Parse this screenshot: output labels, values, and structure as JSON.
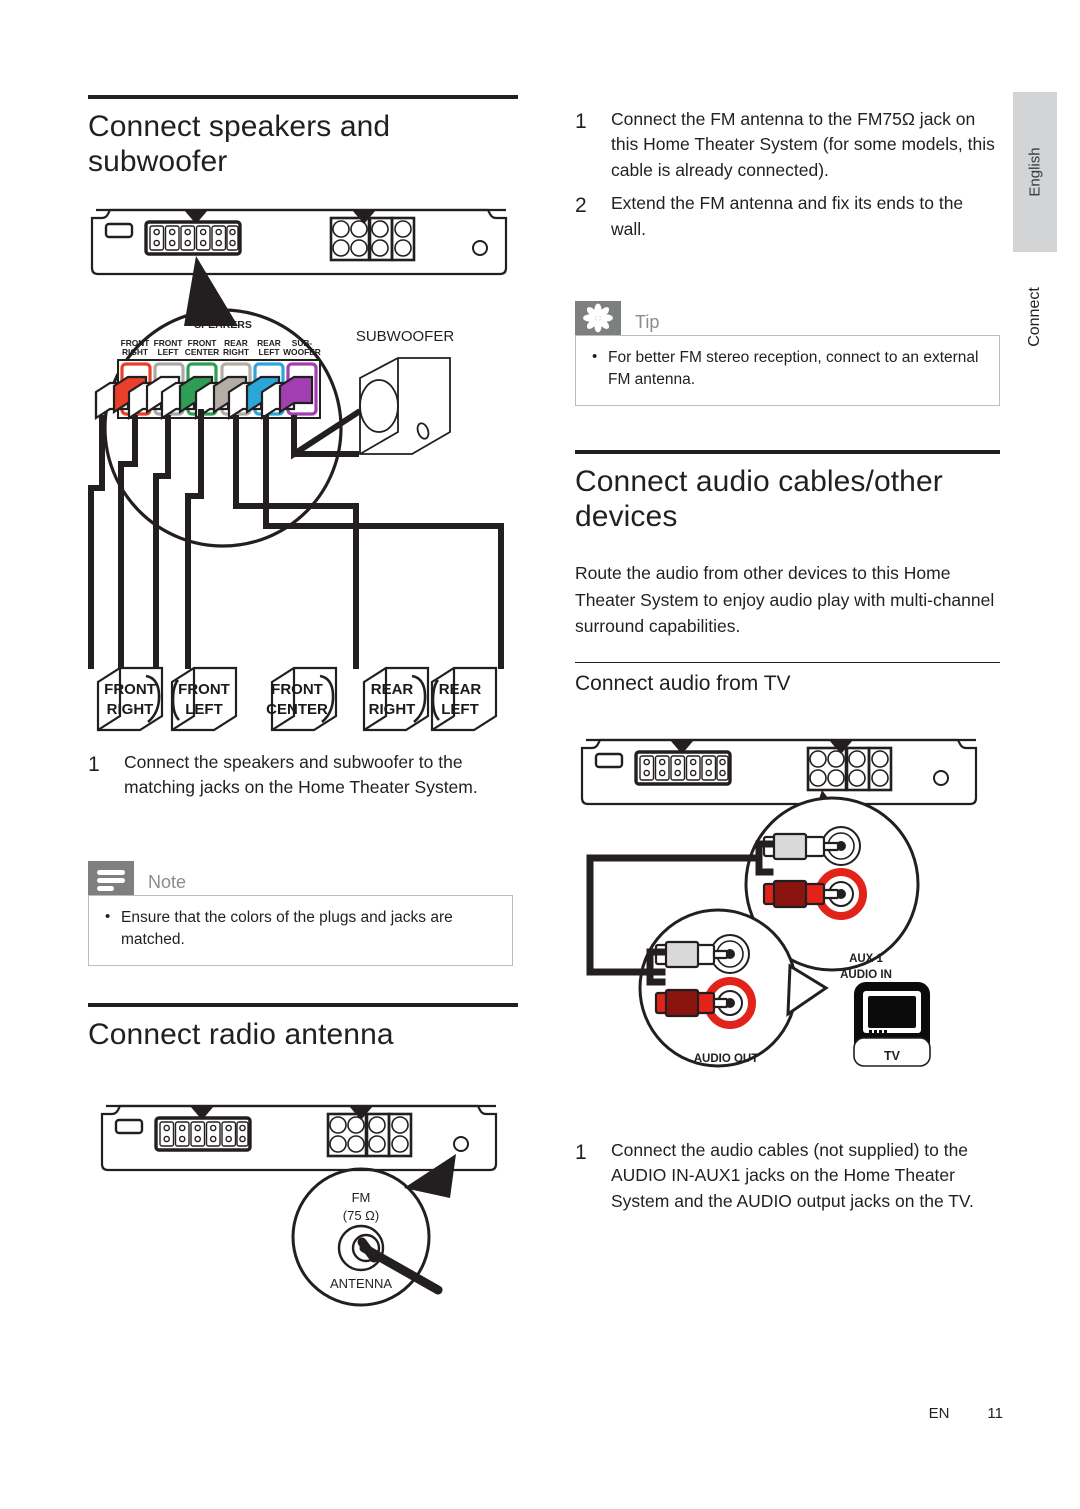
{
  "sidebar": {
    "language_tab": "English",
    "section_tab": "Connect"
  },
  "footer": {
    "lang_code": "EN",
    "page_number": "11"
  },
  "left_column": {
    "section_title": "Connect speakers and subwoofer",
    "rear_panel_diagram": {
      "name": "rear-panel-speaker-jacks",
      "callout_title": "SPEAKERS",
      "jacks": [
        {
          "label_line1": "FRONT",
          "label_line2": "RIGHT",
          "color": "#e8402a"
        },
        {
          "label_line1": "FRONT",
          "label_line2": "LEFT",
          "color": "#ffffff"
        },
        {
          "label_line1": "FRONT",
          "label_line2": "CENTER",
          "color": "#2d9e54"
        },
        {
          "label_line1": "REAR",
          "label_line2": "RIGHT",
          "color": "#b3aea4"
        },
        {
          "label_line1": "REAR",
          "label_line2": "LEFT",
          "color": "#2ba6d9"
        },
        {
          "label_line1": "SUB-",
          "label_line2": "WOOFER",
          "color": "#a23fb0"
        }
      ],
      "subwoofer_label": "SUBWOOFER",
      "speaker_labels": [
        {
          "line1": "FRONT",
          "line2": "RIGHT"
        },
        {
          "line1": "FRONT",
          "line2": "LEFT"
        },
        {
          "line1": "FRONT",
          "line2": "CENTER"
        },
        {
          "line1": "REAR",
          "line2": "RIGHT"
        },
        {
          "line1": "REAR",
          "line2": "LEFT"
        }
      ]
    },
    "step1": {
      "number": "1",
      "text": "Connect the speakers and subwoofer to the matching jacks on the Home Theater System."
    },
    "note": {
      "title": "Note",
      "items": [
        "Ensure that the colors of the plugs and jacks are matched."
      ]
    },
    "antenna_section_title": "Connect radio antenna",
    "antenna_diagram": {
      "name": "rear-panel-fm-antenna-jack",
      "label_line1": "FM",
      "label_line2": "(75 Ω)",
      "label_line3": "ANTENNA"
    }
  },
  "right_column": {
    "steps_antenna": [
      {
        "number": "1",
        "text": "Connect the FM antenna to the FM75Ω jack on this Home Theater System (for some models, this cable is already connected)."
      },
      {
        "number": "2",
        "text": "Extend the FM antenna and fix its ends to the wall."
      }
    ],
    "tip": {
      "title": "Tip",
      "items": [
        "For better FM stereo reception, connect to an external FM antenna."
      ]
    },
    "section_title": "Connect audio cables/other devices",
    "intro": "Route the audio from other devices to this Home Theater System to enjoy audio play with multi-channel surround capabilities.",
    "subsection_title": "Connect audio from TV",
    "tv_diagram": {
      "name": "rear-panel-aux-audio-jacks",
      "aux_label_line1": "AUX 1",
      "aux_label_line2": "AUDIO IN",
      "audio_out_label": "AUDIO OUT",
      "tv_label": "TV",
      "red_color": "#e2231a",
      "white_color": "#ffffff"
    },
    "step1": {
      "number": "1",
      "text": "Connect the audio cables (not supplied) to the AUDIO IN-AUX1 jacks on the Home Theater System and the AUDIO output jacks on the TV."
    }
  }
}
